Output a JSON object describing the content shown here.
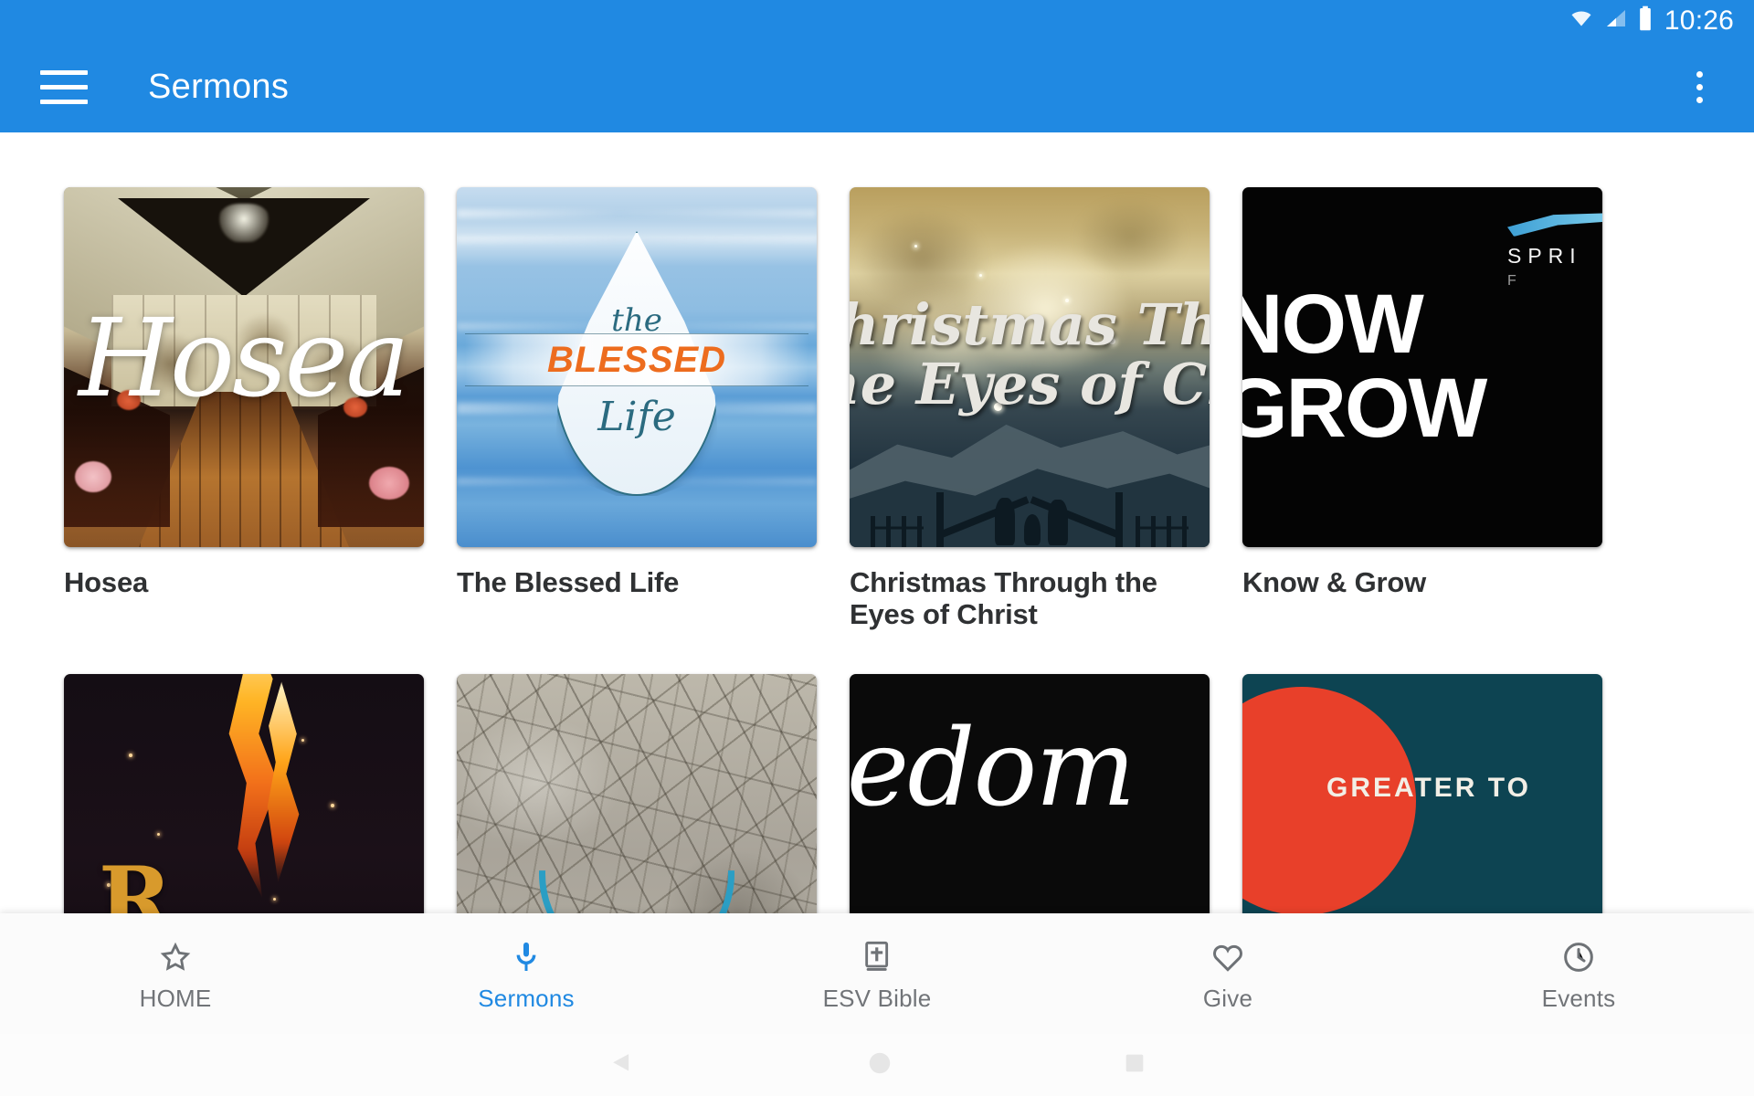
{
  "status_bar": {
    "time": "10:26",
    "icons": [
      "wifi-icon",
      "cellular-signal-icon",
      "battery-icon"
    ]
  },
  "app_bar": {
    "menu_icon": "hamburger-menu-icon",
    "title": "Sermons",
    "overflow_icon": "more-vertical-icon",
    "background_color": "#2089E2"
  },
  "sermon_series": [
    {
      "title": "Hosea",
      "artwork": {
        "style": "photo",
        "overlay_text": "Hosea",
        "description": "rustic barn chapel interior with flowers"
      }
    },
    {
      "title": "The Blessed Life",
      "artwork": {
        "style": "graphic",
        "line1": "the",
        "line2": "BLESSED",
        "line3": "Life",
        "accent_color": "#ED6C1E",
        "description": "water droplet over blue water"
      }
    },
    {
      "title": "Christmas Through the Eyes of Christ",
      "artwork": {
        "style": "photo",
        "overlay_line1": "Christmas Through",
        "overlay_line2": "the Eyes of Christ",
        "description": "golden nebula sky over nativity silhouette"
      }
    },
    {
      "title": "Know & Grow",
      "artwork": {
        "style": "typographic",
        "line1": "NOW",
        "line2": "GROW",
        "logo_text": "SPRI",
        "logo_sub": "F",
        "description": "black background with bold white type and blue swoosh logo"
      }
    },
    {
      "title": "",
      "artwork": {
        "style": "photo",
        "overlay_text": "R",
        "description": "orange flame sparks on dark background"
      }
    },
    {
      "title": "",
      "artwork": {
        "style": "photo",
        "description": "cracked dry earth with teal arc"
      }
    },
    {
      "title": "",
      "artwork": {
        "style": "photo",
        "overlay_text": "eedom",
        "description": "black background with white script"
      }
    },
    {
      "title": "",
      "artwork": {
        "style": "graphic",
        "overlay_text": "GREATER TO",
        "description": "teal background with red circle"
      }
    }
  ],
  "bottom_nav": {
    "active_color": "#2089E2",
    "inactive_color": "#717478",
    "items": [
      {
        "label": "HOME",
        "icon": "star-outline-icon",
        "active": false
      },
      {
        "label": "Sermons",
        "icon": "microphone-icon",
        "active": true
      },
      {
        "label": "ESV Bible",
        "icon": "bible-book-icon",
        "active": false
      },
      {
        "label": "Give",
        "icon": "heart-outline-icon",
        "active": false
      },
      {
        "label": "Events",
        "icon": "clock-icon",
        "active": false
      }
    ]
  },
  "system_nav": {
    "items": [
      "back-icon",
      "home-icon",
      "recents-icon"
    ]
  }
}
